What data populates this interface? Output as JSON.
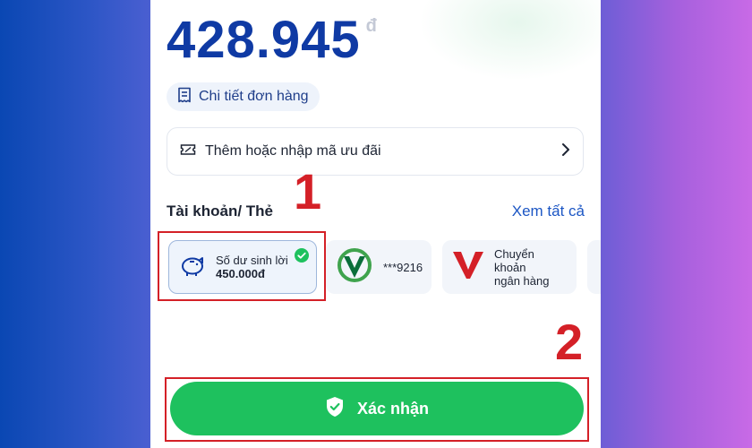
{
  "payment": {
    "amount": "428.945",
    "currency_symbol": "đ",
    "order_detail_label": "Chi tiết đơn hàng",
    "promo_label": "Thêm hoặc nhập mã ưu đãi"
  },
  "accounts": {
    "section_title": "Tài khoản/ Thẻ",
    "see_all_label": "Xem tất cả",
    "cards": [
      {
        "title": "Số dư sinh lời",
        "balance": "450.000đ",
        "icon": "piggy-bank-icon",
        "selected": true
      },
      {
        "masked_number": "***9216",
        "icon": "vietcombank-logo"
      },
      {
        "title_line1": "Chuyển khoản",
        "title_line2": "ngân hàng",
        "icon": "bank-transfer-v-logo"
      }
    ]
  },
  "confirm_label": "Xác nhận",
  "annotations": {
    "step1": "1",
    "step2": "2"
  },
  "colors": {
    "primary_blue": "#0f3aa4",
    "link_blue": "#1c56c4",
    "confirm_green": "#1ec15e",
    "annotation_red": "#d42027"
  }
}
